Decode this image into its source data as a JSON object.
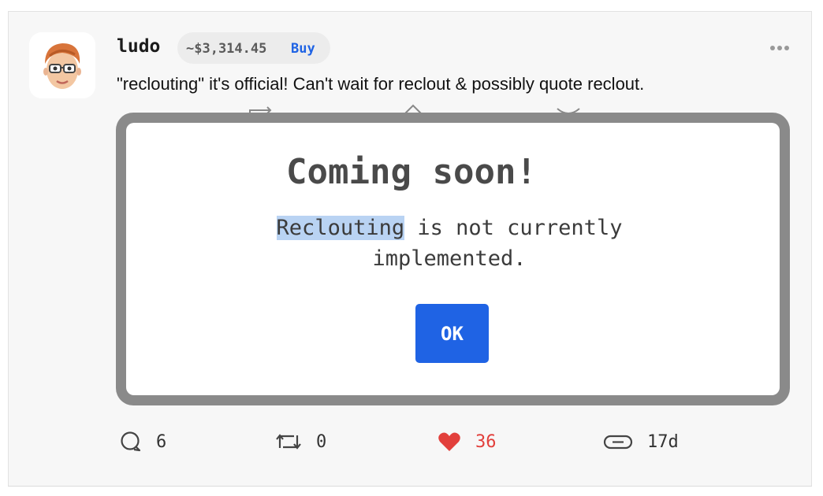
{
  "post": {
    "username": "ludo",
    "coin_price": "~$3,314.45",
    "buy_label": "Buy",
    "text": "\"reclouting\" it's official! Can't wait for reclout & possibly quote reclout."
  },
  "modal": {
    "title": "Coming soon!",
    "message_highlight": "Reclouting",
    "message_rest_line1": " is not currently",
    "message_line2": "implemented.",
    "ok_label": "OK"
  },
  "actions": {
    "comments": "6",
    "reclouts": "0",
    "likes": "36",
    "age": "17d"
  },
  "colors": {
    "accent": "#1f63e4",
    "like": "#e2403c"
  }
}
